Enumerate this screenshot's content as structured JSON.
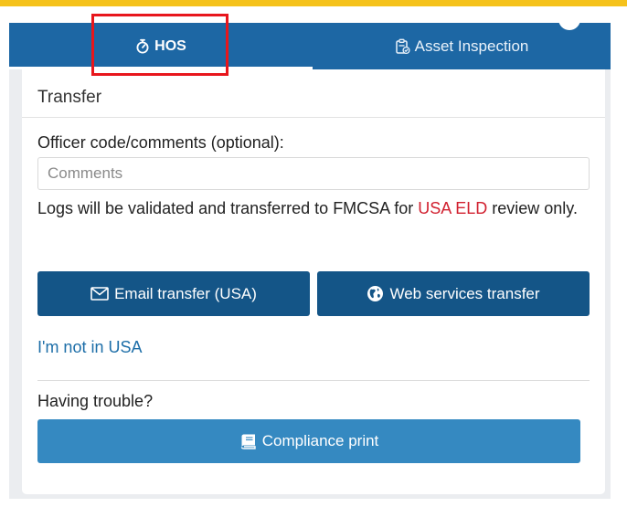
{
  "colors": {
    "accent_strip": "#f5c21b",
    "tabbar": "#1d67a4",
    "primary_button": "#145587",
    "secondary_button": "#3589c1",
    "link": "#1d6ea8",
    "highlight": "#e8161c",
    "usa_eld": "#d1202f"
  },
  "tabs": {
    "hos": {
      "label": "HOS",
      "icon": "stopwatch-icon"
    },
    "asset": {
      "label": "Asset Inspection",
      "icon": "clipboard-check-icon"
    }
  },
  "transfer": {
    "title": "Transfer",
    "field_label": "Officer code/comments (optional):",
    "comments_placeholder": "Comments",
    "comments_value": "",
    "notice_before": "Logs will be validated and transferred to FMCSA for ",
    "notice_highlight": "USA ELD",
    "notice_after": " review only."
  },
  "buttons": {
    "email": {
      "label": "Email transfer (USA)",
      "icon": "envelope-icon"
    },
    "web": {
      "label": "Web services transfer",
      "icon": "globe-icon"
    },
    "print": {
      "label": "Compliance print",
      "icon": "book-icon"
    }
  },
  "links": {
    "not_in_usa": "I'm not in USA"
  },
  "trouble": {
    "label": "Having trouble?"
  }
}
